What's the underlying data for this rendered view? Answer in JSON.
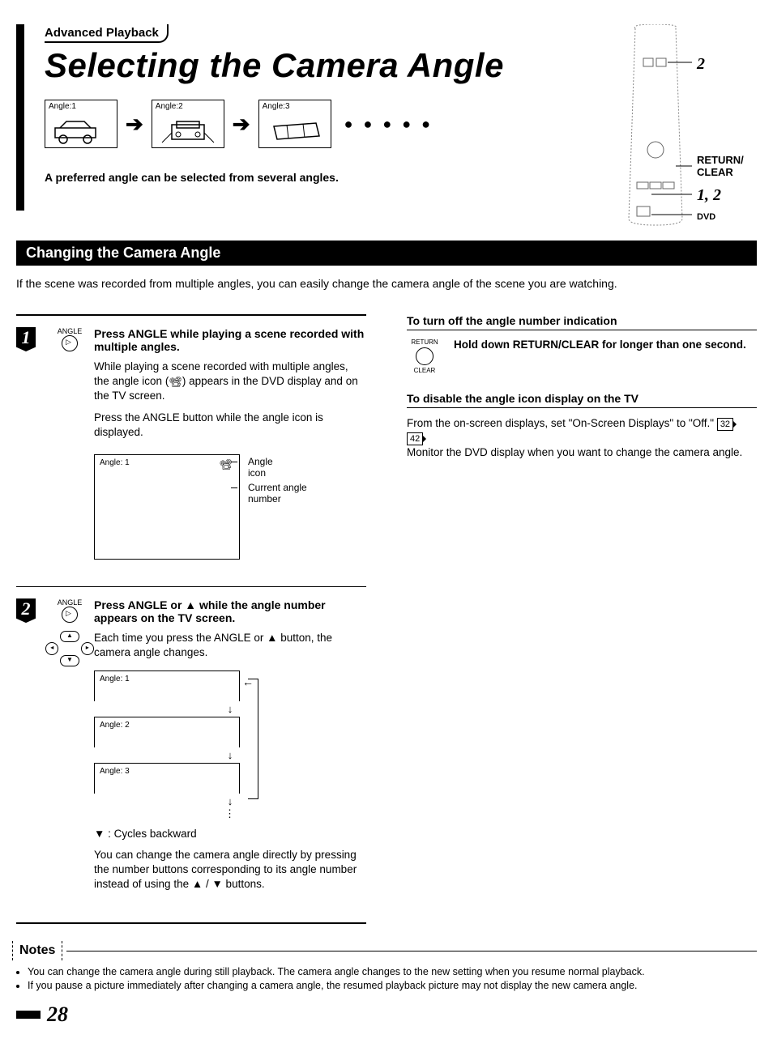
{
  "section_tag": "Advanced Playback",
  "title": "Selecting the Camera Angle",
  "angle_boxes": [
    "Angle:1",
    "Angle:2",
    "Angle:3"
  ],
  "preferred_text": "A preferred angle can be selected from several angles.",
  "remote": {
    "c2": "2",
    "rc": "RETURN/ CLEAR",
    "c12": "1, 2",
    "dvd": "DVD"
  },
  "section_heading": "Changing the Camera Angle",
  "intro": "If the scene was recorded from multiple angles, you can easily change the camera angle of the scene you are watching.",
  "step1": {
    "num": "1",
    "icon_label": "ANGLE",
    "heading": "Press ANGLE while playing a scene recorded with multiple angles.",
    "p1a": "While playing a scene recorded with multiple angles, the angle icon (",
    "p1b": ") appears in the DVD display and on the TV screen.",
    "p2": "Press the ANGLE button while the angle icon is displayed.",
    "box_label": "Angle: 1",
    "callout1": "Angle icon",
    "callout2": "Current angle number"
  },
  "step2": {
    "num": "2",
    "icon_label": "ANGLE",
    "heading": "Press ANGLE or ▲ while the angle number appears on the TV screen.",
    "p1": "Each time you press the ANGLE or ▲ button, the camera angle changes.",
    "a1": "Angle: 1",
    "a2": "Angle: 2",
    "a3": "Angle: 3",
    "cycles": "▼ : Cycles backward",
    "p2": "You can change the camera angle directly by pressing the number buttons corresponding to its angle number instead of using the ▲ / ▼ buttons."
  },
  "right": {
    "sub1": "To turn off the angle number indication",
    "ic_top": "RETURN",
    "ic_bot": "CLEAR",
    "txt1": "Hold down RETURN/CLEAR for longer than one second.",
    "sub2": "To disable the angle icon display on the TV",
    "p1a": "From the on-screen displays, set \"On-Screen Displays\" to \"Off.\" ",
    "ref1": "32",
    "ref2": "42",
    "p1b": "Monitor the DVD display when you want to change the camera angle."
  },
  "notes_label": "Notes",
  "notes": [
    "You can change the camera angle during still playback. The camera angle changes to the new setting when you resume normal playback.",
    "If you pause a picture immediately after changing a camera angle, the resumed playback picture may not display the new camera angle."
  ],
  "page_number": "28"
}
